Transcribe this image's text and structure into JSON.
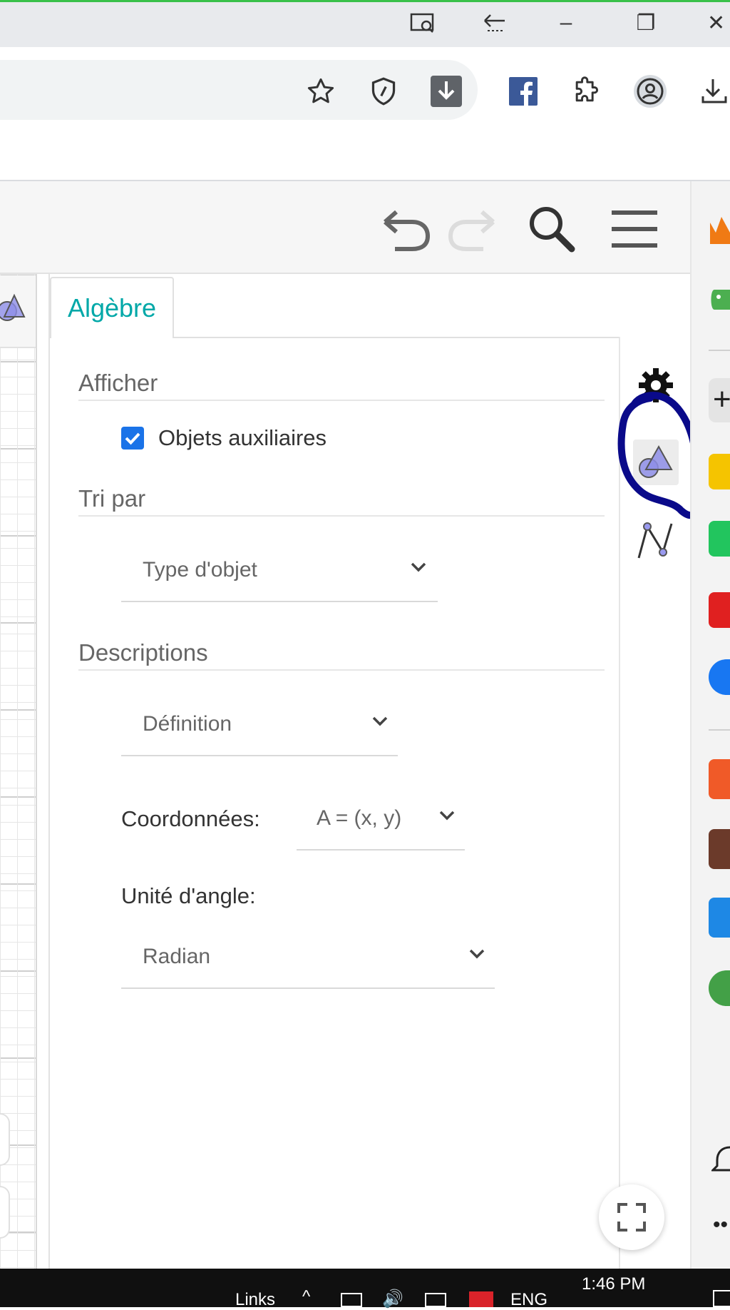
{
  "browser": {
    "window_controls": {
      "minimize": "–",
      "restore": "❐",
      "close": "✕"
    },
    "icons": [
      "screen-search-icon",
      "back-history-icon",
      "star-icon",
      "shield-icon",
      "download-box-icon",
      "facebook-icon",
      "extensions-icon",
      "profile-icon",
      "download-icon"
    ]
  },
  "app_header": {
    "icons": [
      "undo-icon",
      "redo-icon",
      "search-icon",
      "menu-icon"
    ]
  },
  "panel": {
    "tab_label": "Algèbre",
    "afficher": {
      "title": "Afficher",
      "checkbox_label": "Objets auxiliaires",
      "checked": true
    },
    "tri_par": {
      "title": "Tri par",
      "selected": "Type d'objet"
    },
    "descriptions": {
      "title": "Descriptions",
      "selected": "Définition"
    },
    "coordonnees": {
      "label": "Coordonnées:",
      "selected": "A = (x, y)"
    },
    "angle": {
      "label": "Unité d'angle:",
      "selected": "Radian"
    }
  },
  "side_icons": [
    "settings-gear-icon",
    "algebra-shapes-icon",
    "graphics-icon"
  ],
  "colors": {
    "accent": "#00a8a8",
    "checkbox": "#1a73e8",
    "annotation": "#0a0a8a",
    "shape_fill": "#8e8ee8"
  },
  "taskbar": {
    "links": "Links",
    "lang": "ENG",
    "time": "1:46 PM"
  }
}
